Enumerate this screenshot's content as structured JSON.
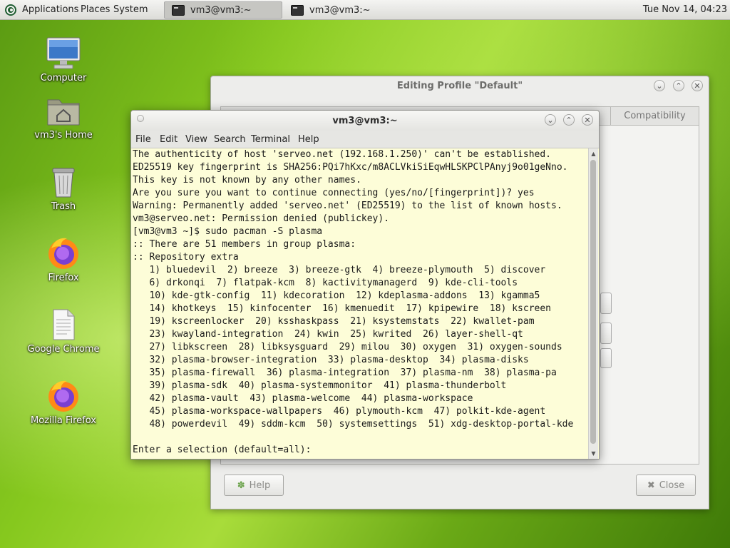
{
  "panel": {
    "menus": [
      "Applications",
      "Places",
      "System"
    ],
    "tasks": [
      {
        "label": "vm3@vm3:~",
        "active": true
      },
      {
        "label": "vm3@vm3:~",
        "active": false
      }
    ],
    "clock": "Tue Nov 14, 04:23"
  },
  "desktop": {
    "icons": [
      {
        "label": "Computer",
        "icon": "computer-icon"
      },
      {
        "label": "vm3's Home",
        "icon": "home-folder-icon"
      },
      {
        "label": "Trash",
        "icon": "trash-icon"
      },
      {
        "label": "Firefox",
        "icon": "firefox-icon"
      },
      {
        "label": "Google Chrome",
        "icon": "document-icon"
      },
      {
        "label": "Mozilla Firefox",
        "icon": "firefox-icon"
      }
    ]
  },
  "profile_dialog": {
    "title": "Editing Profile \"Default\"",
    "visible_tab": "Compatibility",
    "help_label": "Help",
    "close_label": "Close"
  },
  "terminal": {
    "title": "vm3@vm3:~",
    "menu": [
      "File",
      "Edit",
      "View",
      "Search",
      "Terminal",
      "Help"
    ],
    "lines": [
      "The authenticity of host 'serveo.net (192.168.1.250)' can't be established.",
      "ED25519 key fingerprint is SHA256:PQi7hKxc/m8ACLVkiSiEqwHLSKPClPAnyj9o01geNno.",
      "This key is not known by any other names.",
      "Are you sure you want to continue connecting (yes/no/[fingerprint])? yes",
      "Warning: Permanently added 'serveo.net' (ED25519) to the list of known hosts.",
      "vm3@serveo.net: Permission denied (publickey).",
      "[vm3@vm3 ~]$ sudo pacman -S plasma",
      ":: There are 51 members in group plasma:",
      ":: Repository extra",
      "   1) bluedevil  2) breeze  3) breeze-gtk  4) breeze-plymouth  5) discover",
      "   6) drkonqi  7) flatpak-kcm  8) kactivitymanagerd  9) kde-cli-tools",
      "   10) kde-gtk-config  11) kdecoration  12) kdeplasma-addons  13) kgamma5",
      "   14) khotkeys  15) kinfocenter  16) kmenuedit  17) kpipewire  18) kscreen",
      "   19) kscreenlocker  20) ksshaskpass  21) ksystemstats  22) kwallet-pam",
      "   23) kwayland-integration  24) kwin  25) kwrited  26) layer-shell-qt",
      "   27) libkscreen  28) libksysguard  29) milou  30) oxygen  31) oxygen-sounds",
      "   32) plasma-browser-integration  33) plasma-desktop  34) plasma-disks",
      "   35) plasma-firewall  36) plasma-integration  37) plasma-nm  38) plasma-pa",
      "   39) plasma-sdk  40) plasma-systemmonitor  41) plasma-thunderbolt",
      "   42) plasma-vault  43) plasma-welcome  44) plasma-workspace",
      "   45) plasma-workspace-wallpapers  46) plymouth-kcm  47) polkit-kde-agent",
      "   48) powerdevil  49) sddm-kcm  50) systemsettings  51) xdg-desktop-portal-kde",
      "",
      "Enter a selection (default=all): "
    ]
  }
}
